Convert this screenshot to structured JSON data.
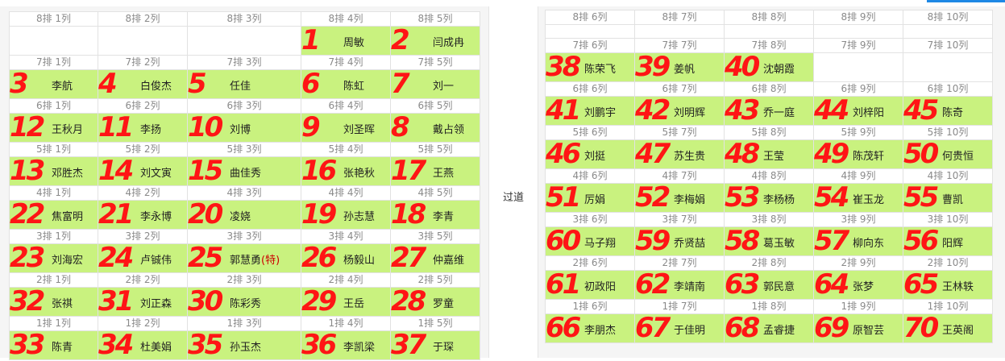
{
  "aisle_label": "过道",
  "colors": {
    "occupied": "#c9f27f",
    "empty": "#ffffff",
    "handwriting": "#ff1515",
    "header_text": "#8a8a8a"
  },
  "left_block": {
    "rows": [
      {
        "headers": [
          "8排 1列",
          "8排 2列",
          "8排 3列",
          "8排 4列",
          "8排 5列"
        ],
        "seats": [
          {
            "name": "",
            "mark": ""
          },
          {
            "name": "",
            "mark": ""
          },
          {
            "name": "",
            "mark": ""
          },
          {
            "name": "周敏",
            "mark": "1"
          },
          {
            "name": "闫成冉",
            "mark": "2"
          }
        ]
      },
      {
        "headers": [
          "7排 1列",
          "7排 2列",
          "7排 3列",
          "7排 4列",
          "7排 5列"
        ],
        "seats": [
          {
            "name": "李航",
            "mark": "3"
          },
          {
            "name": "白俊杰",
            "mark": "4"
          },
          {
            "name": "任佳",
            "mark": "5"
          },
          {
            "name": "陈虹",
            "mark": "6"
          },
          {
            "name": "刘一",
            "mark": "7"
          }
        ]
      },
      {
        "headers": [
          "6排 1列",
          "6排 2列",
          "6排 3列",
          "6排 4列",
          "6排 5列"
        ],
        "seats": [
          {
            "name": "王秋月",
            "mark": "12"
          },
          {
            "name": "李扬",
            "mark": "11"
          },
          {
            "name": "刘博",
            "mark": "10"
          },
          {
            "name": "刘圣晖",
            "mark": "9"
          },
          {
            "name": "戴占领",
            "mark": "8"
          }
        ]
      },
      {
        "headers": [
          "5排 1列",
          "5排 2列",
          "5排 3列",
          "5排 4列",
          "5排 5列"
        ],
        "seats": [
          {
            "name": "邓胜杰",
            "mark": "13"
          },
          {
            "name": "刘文寅",
            "mark": "14"
          },
          {
            "name": "曲佳秀",
            "mark": "15"
          },
          {
            "name": "张艳秋",
            "mark": "16"
          },
          {
            "name": "王燕",
            "mark": "17"
          }
        ]
      },
      {
        "headers": [
          "4排 1列",
          "4排 2列",
          "4排 3列",
          "4排 4列",
          "4排 5列"
        ],
        "seats": [
          {
            "name": "焦富明",
            "mark": "22"
          },
          {
            "name": "李永博",
            "mark": "21"
          },
          {
            "name": "凌娆",
            "mark": "20"
          },
          {
            "name": "孙志慧",
            "mark": "19"
          },
          {
            "name": "李青",
            "mark": "18"
          }
        ]
      },
      {
        "headers": [
          "3排 1列",
          "3排 2列",
          "3排 3列",
          "3排 4列",
          "3排 5列"
        ],
        "seats": [
          {
            "name": "刘海宏",
            "mark": "23"
          },
          {
            "name": "卢铖伟",
            "mark": "24"
          },
          {
            "name": "郭慧勇",
            "tag": "(特)",
            "mark": "25"
          },
          {
            "name": "杨毅山",
            "mark": "26"
          },
          {
            "name": "仲嘉维",
            "mark": "27"
          }
        ]
      },
      {
        "headers": [
          "2排 1列",
          "2排 2列",
          "2排 3列",
          "2排 4列",
          "2排 5列"
        ],
        "seats": [
          {
            "name": "张祺",
            "mark": "32"
          },
          {
            "name": "刘正森",
            "mark": "31"
          },
          {
            "name": "陈彩秀",
            "mark": "30"
          },
          {
            "name": "王岳",
            "mark": "29"
          },
          {
            "name": "罗童",
            "mark": "28"
          }
        ]
      },
      {
        "headers": [
          "1排 1列",
          "1排 2列",
          "1排 3列",
          "1排 4列",
          "1排 5列"
        ],
        "seats": [
          {
            "name": "陈青",
            "mark": "33"
          },
          {
            "name": "杜美娟",
            "mark": "34"
          },
          {
            "name": "孙玉杰",
            "mark": "35"
          },
          {
            "name": "李凯梁",
            "mark": "36"
          },
          {
            "name": "于琛",
            "mark": "37"
          }
        ]
      }
    ]
  },
  "right_block": {
    "rows": [
      {
        "headers": [
          "8排 6列",
          "8排 7列",
          "8排 8列",
          "8排 9列",
          "8排 10列"
        ],
        "seats": [
          {
            "name": "",
            "mark": ""
          },
          {
            "name": "",
            "mark": ""
          },
          {
            "name": "",
            "mark": ""
          },
          {
            "name": "",
            "mark": ""
          },
          {
            "name": "",
            "mark": ""
          }
        ]
      },
      {
        "headers": [
          "7排 6列",
          "7排 7列",
          "7排 8列",
          "7排 9列",
          "7排 10列"
        ],
        "seats": [
          {
            "name": "陈荣飞",
            "mark": "38"
          },
          {
            "name": "姜帆",
            "mark": "39"
          },
          {
            "name": "沈朝霞",
            "mark": "40"
          },
          {
            "name": "",
            "mark": ""
          },
          {
            "name": "",
            "mark": ""
          }
        ]
      },
      {
        "headers": [
          "6排 6列",
          "6排 7列",
          "6排 8列",
          "6排 9列",
          "6排 10列"
        ],
        "seats": [
          {
            "name": "刘鹏宇",
            "mark": "41"
          },
          {
            "name": "刘明辉",
            "mark": "42"
          },
          {
            "name": "乔一庭",
            "mark": "43"
          },
          {
            "name": "刘梓阳",
            "mark": "44"
          },
          {
            "name": "陈奇",
            "mark": "45"
          }
        ]
      },
      {
        "headers": [
          "5排 6列",
          "5排 7列",
          "5排 8列",
          "5排 9列",
          "5排 10列"
        ],
        "seats": [
          {
            "name": "刘挺",
            "mark": "46"
          },
          {
            "name": "苏生贵",
            "mark": "47"
          },
          {
            "name": "王莹",
            "mark": "48"
          },
          {
            "name": "陈茂轩",
            "mark": "49"
          },
          {
            "name": "何贵恒",
            "mark": "50"
          }
        ]
      },
      {
        "headers": [
          "4排 6列",
          "4排 7列",
          "4排 8列",
          "4排 9列",
          "4排 10列"
        ],
        "seats": [
          {
            "name": "厉娟",
            "mark": "51"
          },
          {
            "name": "李梅娟",
            "mark": "52"
          },
          {
            "name": "李杨杨",
            "mark": "53"
          },
          {
            "name": "崔玉龙",
            "mark": "54"
          },
          {
            "name": "曹凯",
            "mark": "55"
          }
        ]
      },
      {
        "headers": [
          "3排 6列",
          "3排 7列",
          "3排 8列",
          "3排 9列",
          "3排 10列"
        ],
        "seats": [
          {
            "name": "马子翔",
            "mark": "60"
          },
          {
            "name": "乔贤喆",
            "mark": "59"
          },
          {
            "name": "葛玉敏",
            "mark": "58"
          },
          {
            "name": "柳向东",
            "mark": "57"
          },
          {
            "name": "阳辉",
            "mark": "56"
          }
        ]
      },
      {
        "headers": [
          "2排 6列",
          "2排 7列",
          "2排 8列",
          "2排 9列",
          "2排 10列"
        ],
        "seats": [
          {
            "name": "初政阳",
            "mark": "61"
          },
          {
            "name": "李靖南",
            "mark": "62"
          },
          {
            "name": "郭民意",
            "mark": "63"
          },
          {
            "name": "张梦",
            "mark": "64"
          },
          {
            "name": "王林轶",
            "mark": "65"
          }
        ]
      },
      {
        "headers": [
          "1排 6列",
          "1排 7列",
          "1排 8列",
          "1排 9列",
          "1排 10列"
        ],
        "seats": [
          {
            "name": "李朋杰",
            "mark": "66"
          },
          {
            "name": "于佳明",
            "mark": "67"
          },
          {
            "name": "孟睿捷",
            "mark": "68"
          },
          {
            "name": "原智芸",
            "mark": "69"
          },
          {
            "name": "王英阁",
            "mark": "70"
          }
        ]
      }
    ]
  }
}
